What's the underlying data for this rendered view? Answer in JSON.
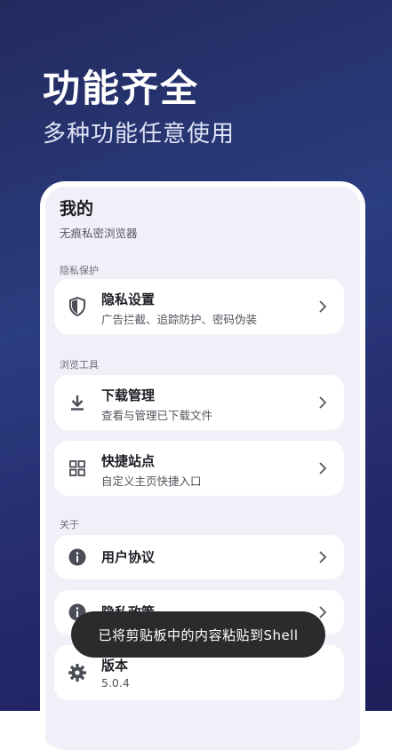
{
  "promo": {
    "headline": "功能齐全",
    "subheadline": "多种功能任意使用"
  },
  "page": {
    "title": "我的",
    "subtitle": "无痕私密浏览器"
  },
  "sections": {
    "privacy": {
      "label": "隐私保护",
      "items": [
        {
          "title": "隐私设置",
          "desc": "广告拦截、追踪防护、密码伪装",
          "icon": "shield-icon"
        }
      ]
    },
    "tools": {
      "label": "浏览工具",
      "items": [
        {
          "title": "下载管理",
          "desc": "查看与管理已下载文件",
          "icon": "download-icon"
        },
        {
          "title": "快捷站点",
          "desc": "自定义主页快捷入口",
          "icon": "grid-icon"
        }
      ]
    },
    "about": {
      "label": "关于",
      "items": [
        {
          "title": "用户协议",
          "icon": "info-icon"
        },
        {
          "title": "隐私政策",
          "icon": "info-icon"
        },
        {
          "title": "版本",
          "desc": "5.0.4",
          "icon": "gear-icon"
        }
      ]
    }
  },
  "toast": {
    "message": "已将剪贴板中的内容粘贴到Shell"
  },
  "colors": {
    "background": "#262f6a",
    "card": "#ffffff",
    "screen": "#f1f0f8",
    "toast": "#2b2b2e"
  }
}
